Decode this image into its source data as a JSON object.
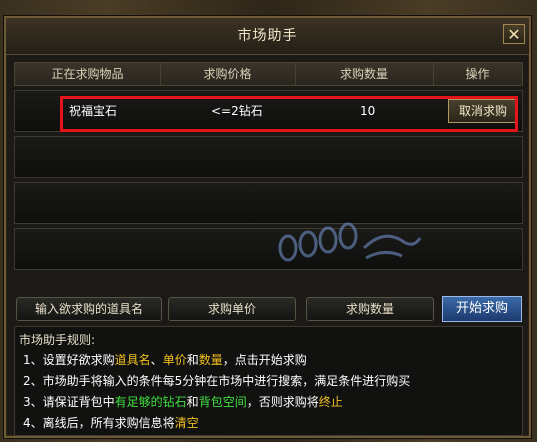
{
  "window": {
    "title": "市场助手",
    "close": "✕"
  },
  "table": {
    "headers": [
      "正在求购物品",
      "求购价格",
      "求购数量",
      "操作"
    ],
    "rows": [
      {
        "item": "祝福宝石",
        "price": "<=2钻石",
        "qty": "10",
        "action": "取消求购"
      }
    ]
  },
  "inputs": {
    "item_placeholder": "输入欲求购的道具名",
    "price_placeholder": "求购单价",
    "qty_placeholder": "求购数量",
    "start_label": "开始求购"
  },
  "rules": {
    "title": "市场助手规则:",
    "r1": {
      "num": "1、",
      "a": "设置好欲求购",
      "b": "道具名",
      "c": "、",
      "d": "单价",
      "e": "和",
      "f": "数量",
      "g": "，点击开始求购"
    },
    "r2": {
      "num": "2、",
      "a": "市场助手将输入的条件每5分钟在市场中进行搜索，满足条件进行购买"
    },
    "r3": {
      "num": "3、",
      "a": "请保证背包中",
      "b": "有足够的钻石",
      "c": "和",
      "d": "背包空间",
      "e": "，否则求购将",
      "f": "终止"
    },
    "r4": {
      "num": "4、",
      "a": "离线后，所有求购信息将",
      "b": "清空"
    }
  },
  "watermark": {
    "logo_text": "8090游戏"
  },
  "colors": {
    "highlight_red": "#e4141a",
    "rule_yellow": "#f0c020",
    "rule_green": "#40e040",
    "start_blue": "#2a5290"
  }
}
